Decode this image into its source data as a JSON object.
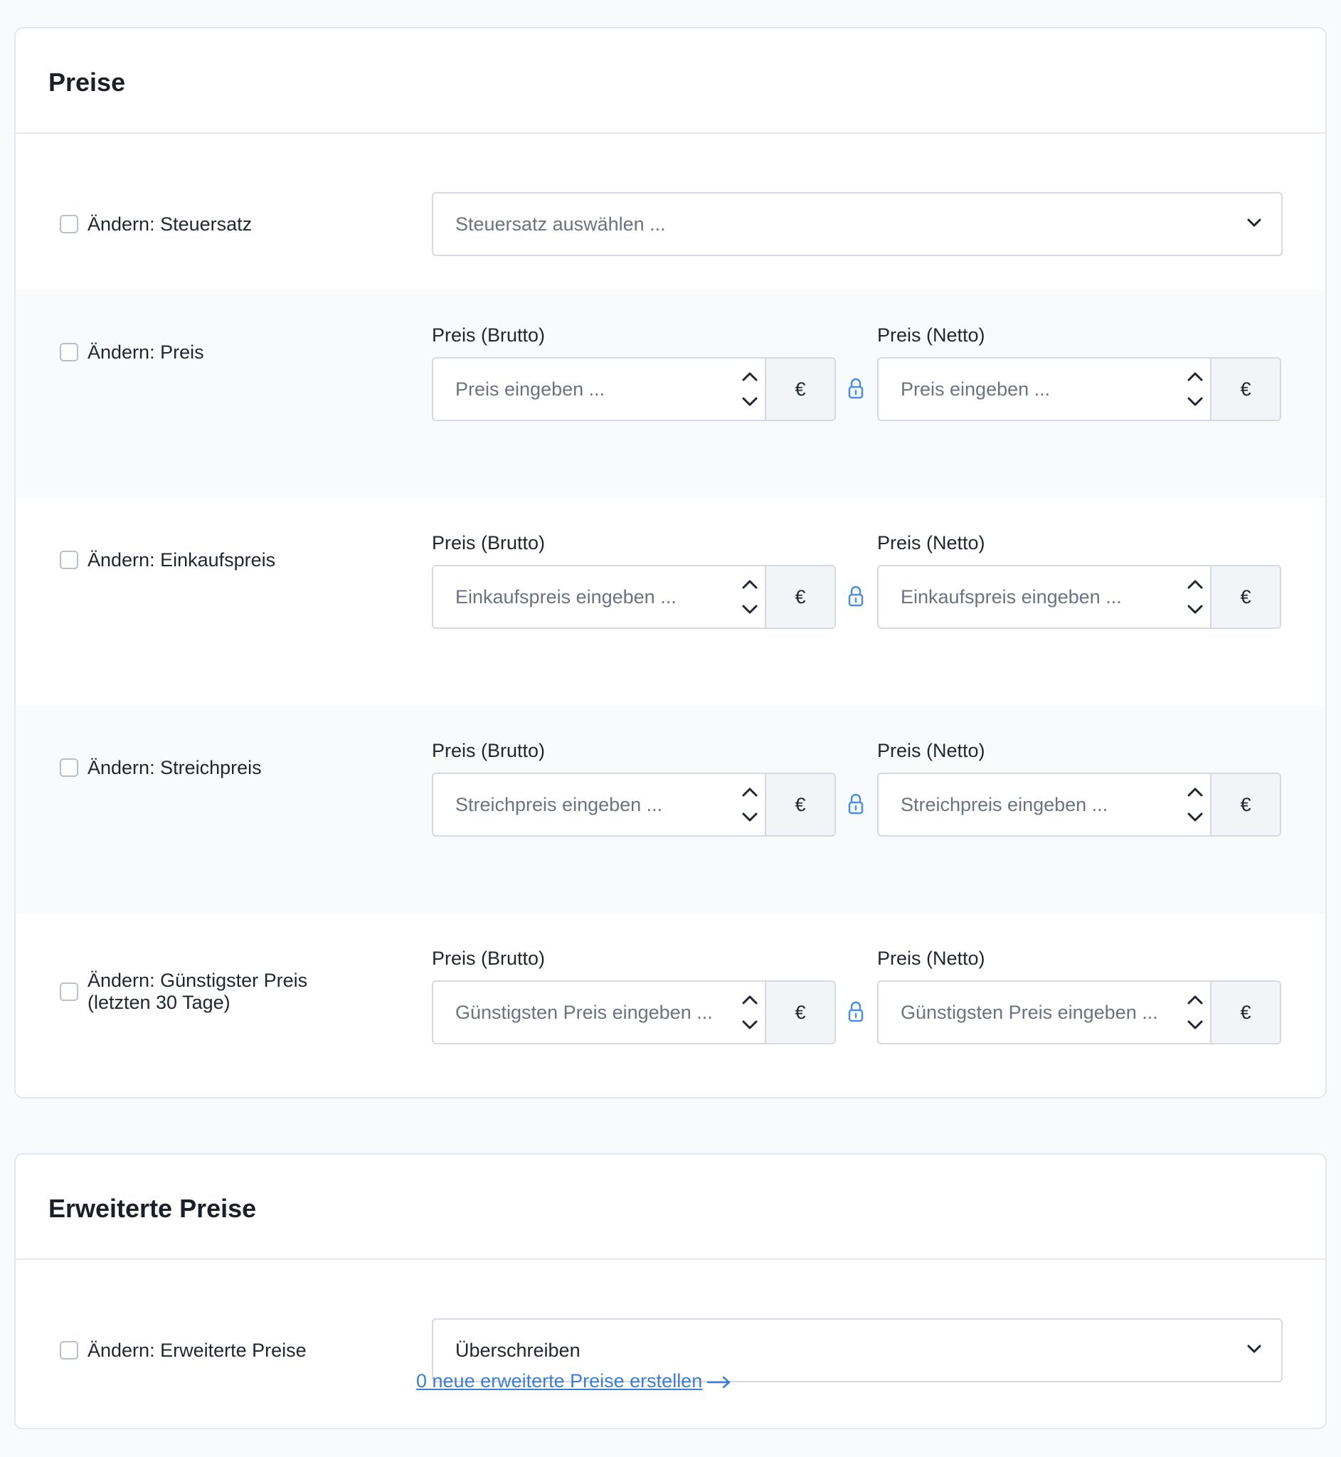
{
  "sections": {
    "preise": {
      "title": "Preise",
      "rows": {
        "steuersatz": {
          "label": "Ändern: Steuersatz",
          "select_placeholder": "Steuersatz auswählen ..."
        },
        "preis": {
          "label": "Ändern: Preis",
          "gross_label": "Preis (Brutto)",
          "net_label": "Preis (Netto)",
          "gross_placeholder": "Preis eingeben ...",
          "net_placeholder": "Preis eingeben ...",
          "currency": "€"
        },
        "einkaufspreis": {
          "label": "Ändern: Einkaufspreis",
          "gross_label": "Preis (Brutto)",
          "net_label": "Preis (Netto)",
          "gross_placeholder": "Einkaufspreis eingeben ...",
          "net_placeholder": "Einkaufspreis eingeben ...",
          "currency": "€"
        },
        "streichpreis": {
          "label": "Ändern: Streichpreis",
          "gross_label": "Preis (Brutto)",
          "net_label": "Preis (Netto)",
          "gross_placeholder": "Streichpreis eingeben ...",
          "net_placeholder": "Streichpreis eingeben ...",
          "currency": "€"
        },
        "guenstigster": {
          "label_line1": "Ändern: Günstigster Preis",
          "label_line2": "(letzten 30 Tage)",
          "gross_label": "Preis (Brutto)",
          "net_label": "Preis (Netto)",
          "gross_placeholder": "Günstigsten Preis eingeben ...",
          "net_placeholder": "Günstigsten Preis eingeben ...",
          "currency": "€"
        }
      }
    },
    "erweiterte_preise": {
      "title": "Erweiterte Preise",
      "row": {
        "label": "Ändern: Erweiterte Preise",
        "select_value": "Überschreiben",
        "link_text": "0 neue erweiterte Preise erstellen"
      }
    }
  },
  "colors": {
    "accent_link": "#3b7ed3",
    "lock_icon": "#4a8fe0",
    "border": "#d5dae2"
  }
}
